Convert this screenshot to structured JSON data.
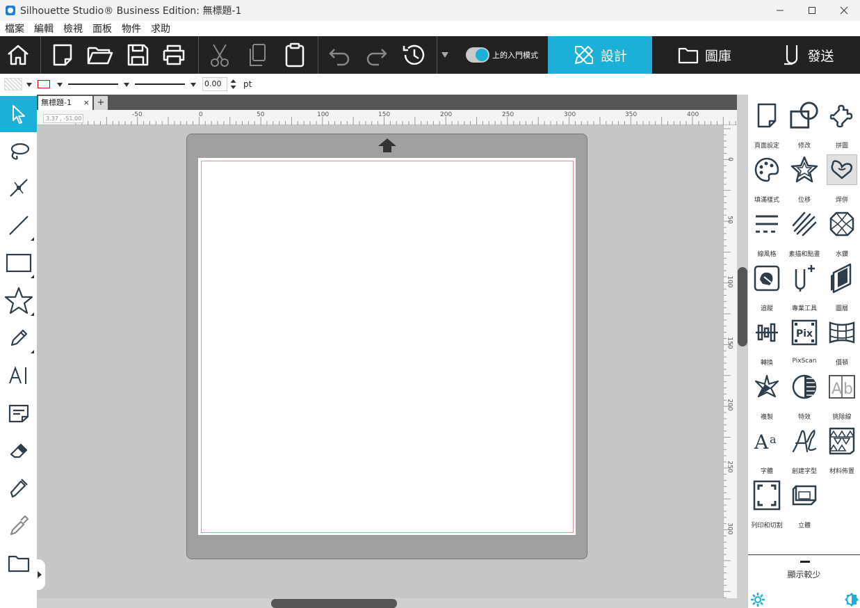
{
  "window": {
    "title": "Silhouette Studio® Business Edition: 無標題-1"
  },
  "menu": [
    "檔案",
    "編輯",
    "檢視",
    "面板",
    "物件",
    "求助"
  ],
  "toolbar": {
    "toggle_label": "上的入門模式",
    "tabs": {
      "design": "設計",
      "library": "圖庫",
      "send": "發送"
    },
    "accent_color": "#1bb0d8"
  },
  "options_bar": {
    "line_width_value": "0.00",
    "line_width_unit": "pt"
  },
  "document_tab": {
    "name": "無標題-1",
    "close": "×",
    "add": "+"
  },
  "ruler": {
    "coord_readout": "3.37 , -51.00",
    "h_labels": [
      "-50",
      "0",
      "50",
      "100",
      "150",
      "200",
      "250",
      "300",
      "350",
      "400"
    ],
    "v_labels": [
      "0",
      "50",
      "100",
      "150",
      "200",
      "250",
      "300"
    ]
  },
  "right_panel": {
    "items": [
      {
        "label": "頁面設定",
        "icon": "page-setup-icon"
      },
      {
        "label": "修改",
        "icon": "modify-icon"
      },
      {
        "label": "拼圖",
        "icon": "puzzle-icon"
      },
      {
        "label": "填滿樣式",
        "icon": "palette-icon"
      },
      {
        "label": "位移",
        "icon": "offset-star-icon"
      },
      {
        "label": "焊併",
        "icon": "weld-hearts-icon"
      },
      {
        "label": "線風格",
        "icon": "line-style-icon"
      },
      {
        "label": "素描和點畫",
        "icon": "sketch-icon"
      },
      {
        "label": "水鑽",
        "icon": "rhinestone-icon"
      },
      {
        "label": "追蹤",
        "icon": "trace-icon"
      },
      {
        "label": "專業工具",
        "icon": "pro-tools-icon"
      },
      {
        "label": "圖層",
        "icon": "layers-icon"
      },
      {
        "label": "轉換",
        "icon": "transform-icon"
      },
      {
        "label": "PixScan",
        "icon": "pixscan-icon"
      },
      {
        "label": "價頓",
        "icon": "warp-icon"
      },
      {
        "label": "複製",
        "icon": "replicate-icon"
      },
      {
        "label": "特效",
        "icon": "effects-icon"
      },
      {
        "label": "挑除線",
        "icon": "weed-lines-icon"
      },
      {
        "label": "字體",
        "icon": "font-icon"
      },
      {
        "label": "創建字型",
        "icon": "create-font-icon"
      },
      {
        "label": "材料佈置",
        "icon": "nesting-icon"
      },
      {
        "label": "列印和切割",
        "icon": "print-cut-icon"
      },
      {
        "label": "立體",
        "icon": "3d-icon"
      }
    ],
    "show_less": "顯示較少"
  }
}
